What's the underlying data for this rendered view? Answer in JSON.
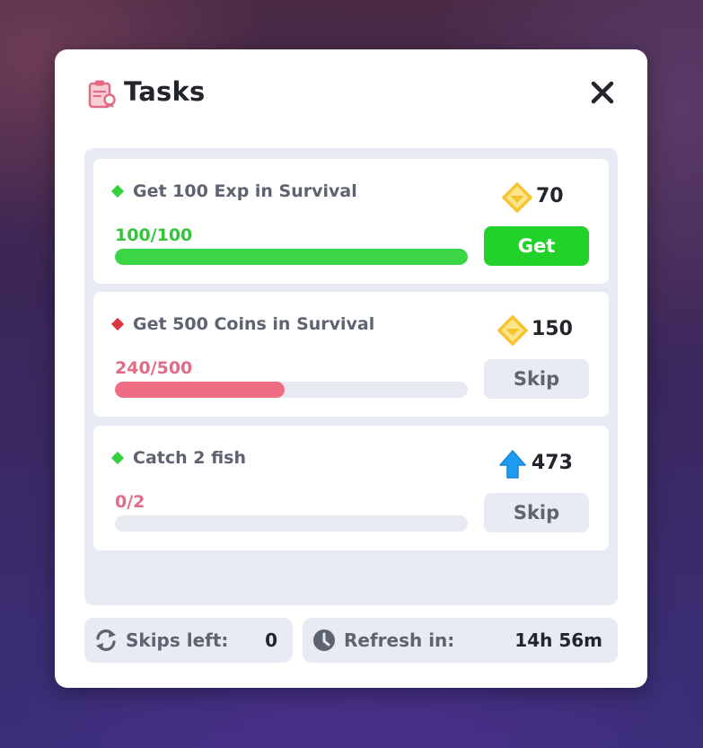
{
  "modal": {
    "title": "Tasks",
    "title_icon": "clipboard-icon",
    "close_icon": "close-icon"
  },
  "tasks": [
    {
      "label": "Get 100 Exp in Survival",
      "status_color": "#35d13e",
      "progress_text": "100/100",
      "progress": 1.0,
      "progress_color": "#3bd645",
      "progress_text_color": "#35c33c",
      "reward_icon": "gem-icon",
      "reward_value": "70",
      "action_label": "Get"
    },
    {
      "label": "Get 500 Coins in Survival",
      "status_color": "#d8363e",
      "progress_text": "240/500",
      "progress": 0.48,
      "progress_color": "#ee6c84",
      "progress_text_color": "#e06c86",
      "reward_icon": "gem-icon",
      "reward_value": "150",
      "action_label": "Skip"
    },
    {
      "label": "Catch 2 fish",
      "status_color": "#35d13e",
      "progress_text": "0/2",
      "progress": 0,
      "progress_color": "#ee6c84",
      "progress_text_color": "#e06c86",
      "reward_icon": "up-arrow-icon",
      "reward_value": "473",
      "action_label": "Skip"
    }
  ],
  "footer": {
    "skips_label": "Skips left:",
    "skips_value": "0",
    "skips_icon": "refresh-icon",
    "refresh_label": "Refresh in:",
    "refresh_value": "14h 56m",
    "refresh_icon": "clock-icon"
  },
  "colors": {
    "accent_green": "#22d12a",
    "gem_gold": "#f6c431",
    "arrow_blue": "#1d9bf0"
  }
}
